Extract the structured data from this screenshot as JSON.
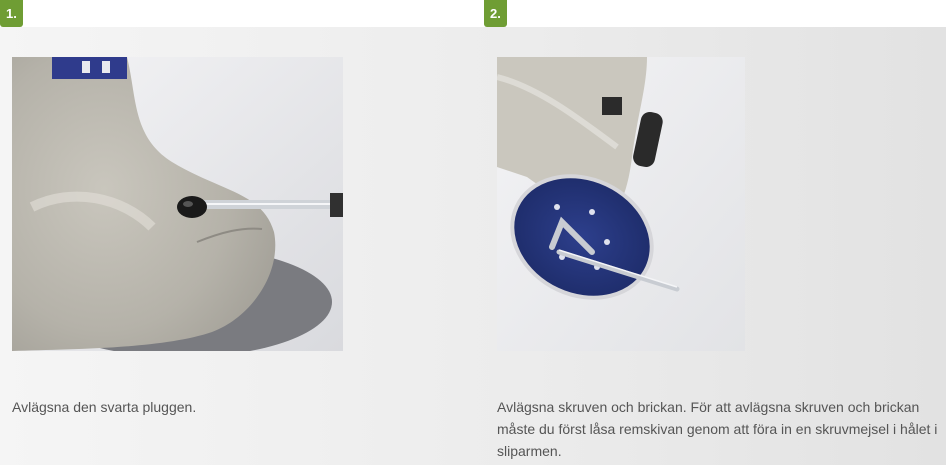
{
  "steps": [
    {
      "badge": "1.",
      "caption": "Avlägsna den svarta pluggen."
    },
    {
      "badge": "2.",
      "caption": "Avlägsna skruven och brickan. För att avlägsna skruven och brickan måste du först låsa remskivan genom att föra in en skruvmejsel i hålet i sliparmen."
    }
  ]
}
